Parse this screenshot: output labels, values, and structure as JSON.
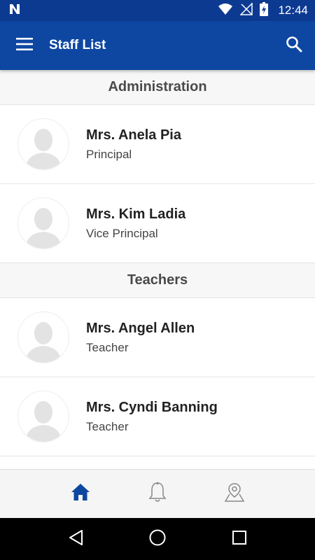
{
  "status_bar": {
    "time": "12:44",
    "icons": [
      "n-logo-icon",
      "wifi-icon",
      "no-signal-icon",
      "battery-charging-icon"
    ]
  },
  "app_bar": {
    "title": "Staff List",
    "menu_icon": "hamburger-menu-icon",
    "search_icon": "search-icon",
    "color": "#0d47a1"
  },
  "sections": [
    {
      "title": "Administration",
      "staff": [
        {
          "name": "Mrs. Anela Pia",
          "role": "Principal"
        },
        {
          "name": "Mrs. Kim Ladia",
          "role": "Vice Principal"
        }
      ]
    },
    {
      "title": "Teachers",
      "staff": [
        {
          "name": "Mrs. Angel Allen",
          "role": "Teacher"
        },
        {
          "name": "Mrs. Cyndi Banning",
          "role": "Teacher"
        }
      ]
    }
  ],
  "bottom_nav": {
    "items": [
      "home-icon",
      "bell-icon",
      "map-pin-icon"
    ],
    "active": "home-icon",
    "active_color": "#0d47a1"
  },
  "system_nav": [
    "back-icon",
    "home-circle-icon",
    "recents-icon"
  ]
}
